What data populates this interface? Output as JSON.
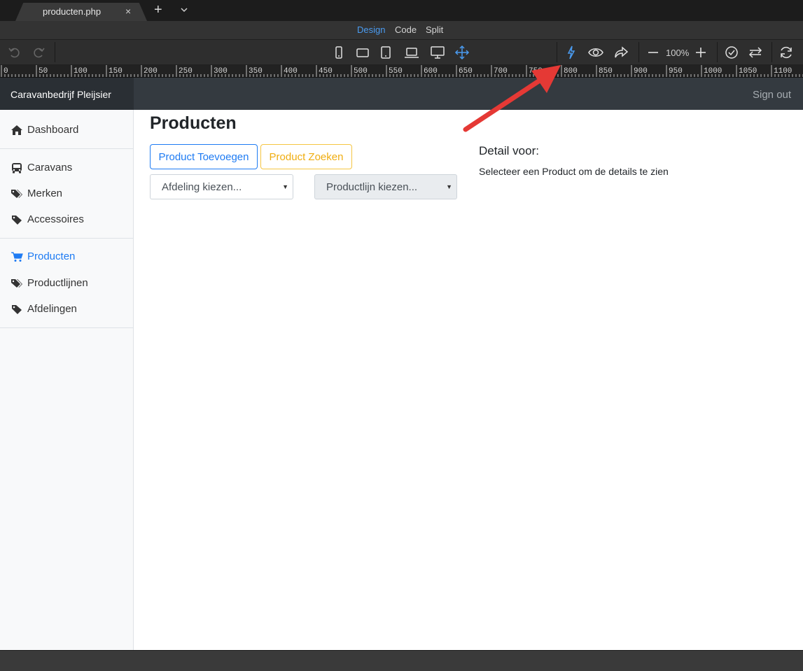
{
  "app": {
    "tab": {
      "title": "producten.php",
      "close": "×",
      "add": "+"
    },
    "views": {
      "design": "Design",
      "code": "Code",
      "split": "Split"
    },
    "toolbar": {
      "zoom": "100%"
    },
    "ruler_ticks": [
      "0",
      "50",
      "100",
      "150",
      "200",
      "250",
      "300",
      "350",
      "400",
      "450",
      "500",
      "550",
      "600",
      "650",
      "700",
      "750",
      "800",
      "850",
      "900",
      "950",
      "1000",
      "1050",
      "1100"
    ],
    "colors": {
      "accent": "#4a9bf0",
      "annotation_arrow": "#e53935"
    }
  },
  "site": {
    "brand": "Caravanbedrijf Pleijsier",
    "signout": "Sign out",
    "sidebar": {
      "groups": [
        [
          {
            "label": "Dashboard",
            "icon": "home-icon"
          }
        ],
        [
          {
            "label": "Caravans",
            "icon": "bus-icon"
          },
          {
            "label": "Merken",
            "icon": "tags-icon"
          },
          {
            "label": "Accessoires",
            "icon": "tag-icon"
          }
        ],
        [
          {
            "label": "Producten",
            "icon": "cart-icon",
            "active": true
          },
          {
            "label": "Productlijnen",
            "icon": "tags-icon"
          },
          {
            "label": "Afdelingen",
            "icon": "tag-icon"
          }
        ]
      ]
    },
    "main": {
      "title": "Producten",
      "add_button": "Product Toevoegen",
      "search_button": "Product Zoeken",
      "afdeling_select": "Afdeling kiezen...",
      "productlijn_select": "Productlijn kiezen...",
      "detail_heading": "Detail voor:",
      "detail_text": "Selecteer een Product om de details te zien"
    },
    "colors": {
      "primary": "#1e7bf3",
      "warning": "#f0ad10",
      "navbar": "#343a40"
    }
  }
}
